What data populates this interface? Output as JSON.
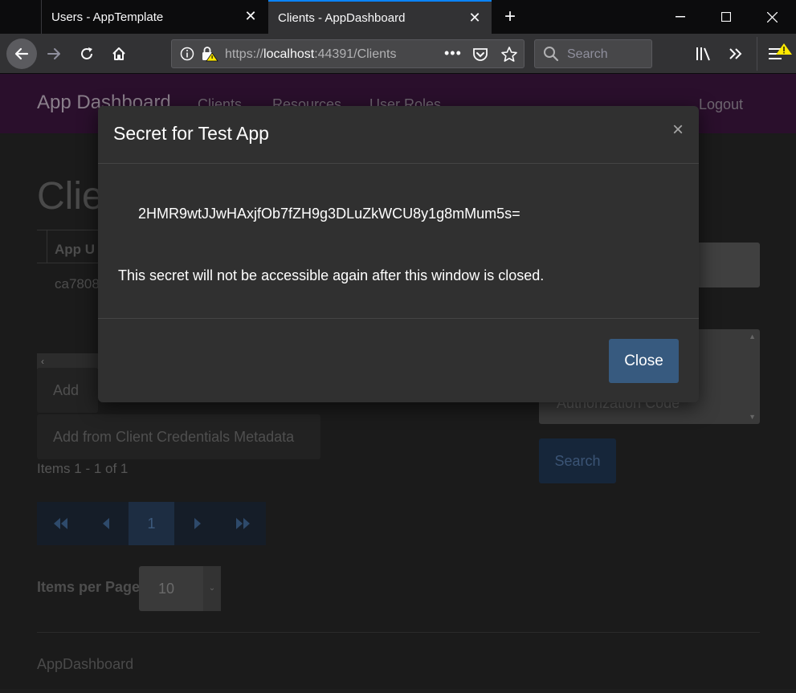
{
  "browser": {
    "tabs": [
      {
        "label": "Users - AppTemplate",
        "active": false
      },
      {
        "label": "Clients - AppDashboard",
        "active": true
      }
    ],
    "url": {
      "scheme": "https://",
      "host": "localhost",
      "rest": ":44391/Clients"
    },
    "search_placeholder": "Search"
  },
  "app": {
    "brand": "App Dashboard",
    "nav": [
      "Clients",
      "Resources",
      "User Roles"
    ],
    "logout": "Logout",
    "page_title": "Clie",
    "grid": {
      "header": "App U",
      "row": "ca7808"
    },
    "buttons": {
      "add": "Add",
      "add_metadata": "Add from Client Credentials Metadata"
    },
    "items_count": "Items 1 - 1 of 1",
    "pager": {
      "current": "1"
    },
    "items_per_page": {
      "label": "Items per Page",
      "value": "10"
    },
    "filter_option": "Authorization Code",
    "search_button": "Search",
    "footer": "AppDashboard"
  },
  "modal": {
    "title": "Secret for Test App",
    "secret": "2HMR9wtJJwHAxjfOb7fZH9g3DLuZkWCU8y1g8mMum5s=",
    "warning": "This secret will not be accessible again after this window is closed.",
    "close_label": "Close",
    "close_symbol": "×"
  },
  "colors": {
    "accent": "#375a7f",
    "navbar": "#2a0f2c",
    "tab_highlight": "#0a84ff",
    "warning_badge": "#ffe900"
  }
}
